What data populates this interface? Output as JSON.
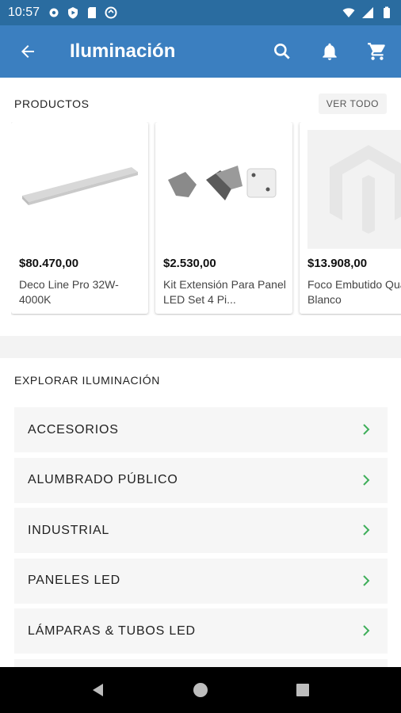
{
  "status_bar": {
    "time": "10:57"
  },
  "app_bar": {
    "title": "Iluminación"
  },
  "products_section": {
    "title": "PRODUCTOS",
    "see_all": "VER TODO",
    "items": [
      {
        "price": "$80.470,00",
        "name": "Deco Line Pro 32W-4000K"
      },
      {
        "price": "$2.530,00",
        "name": "Kit Extensión Para Panel LED Set 4 Pi..."
      },
      {
        "price": "$13.908,00",
        "name": "Foco Embutido Quale-RB Blanco"
      }
    ]
  },
  "explore_section": {
    "title": "EXPLORAR ILUMINACIÓN",
    "categories": [
      {
        "label": "ACCESORIOS"
      },
      {
        "label": "ALUMBRADO PÚBLICO"
      },
      {
        "label": "INDUSTRIAL"
      },
      {
        "label": "PANELES LED"
      },
      {
        "label": "LÁMPARAS & TUBOS LED"
      }
    ]
  },
  "colors": {
    "status_bar": "#2a6ca0",
    "app_bar": "#3b7fc0",
    "accent_green": "#3fae5a"
  }
}
